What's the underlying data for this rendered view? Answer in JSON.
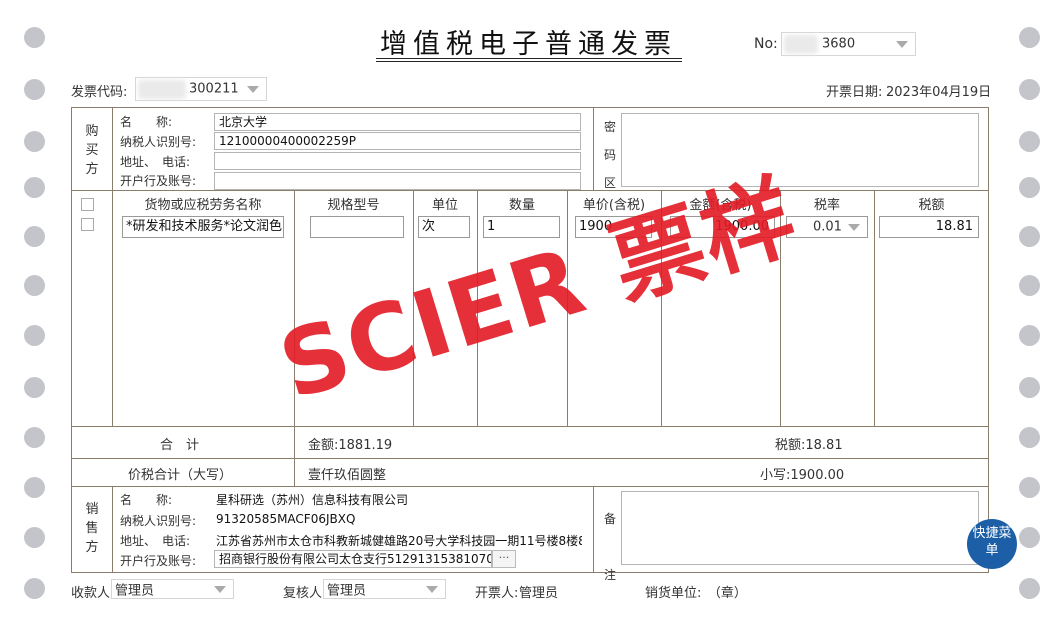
{
  "invoice": {
    "title": "增值税电子普通发票",
    "no_label": "No:",
    "no_value": "3680",
    "code_label": "发票代码:",
    "code_value": "300211",
    "date_label": "开票日期:",
    "date_value": "2023年04月19日"
  },
  "buyer": {
    "section_label": "购买方",
    "name_label": "名　　称:",
    "name_value": "北京大学",
    "tax_id_label": "纳税人识别号:",
    "tax_id_value": "12100000400002259P",
    "address_label": "地址、　电话:",
    "address_value": "",
    "bank_label": "开户行及账号:",
    "bank_value": ""
  },
  "password_label": "密码区",
  "items_header": {
    "goods": "货物或应税劳务名称",
    "spec": "规格型号",
    "unit": "单位",
    "qty": "数量",
    "price": "单价(含税)",
    "amount": "金额(含税)",
    "rate": "税率",
    "tax": "税额"
  },
  "item": {
    "goods": "*研发和技术服务*论文润色",
    "spec": "",
    "unit": "次",
    "qty": "1",
    "price": "1900",
    "amount": "1900.00",
    "rate": "0.01",
    "tax": "18.81"
  },
  "totals": {
    "label": "合　计",
    "amount_text": "金额:1881.19",
    "tax_text": "税额:18.81",
    "sum_label": "价税合计（大写）",
    "sum_upper": "壹仟玖佰圆整",
    "sum_lower": "小写:1900.00"
  },
  "seller": {
    "section_label": "销售方",
    "name_label": "名　　称:",
    "name_value": "星科研选（苏州）信息科技有限公司",
    "tax_id_label": "纳税人识别号:",
    "tax_id_value": "91320585MACF06JBXQ",
    "address_label": "地址、　电话:",
    "address_value": "江苏省苏州市太仓市科教新城健雄路20号大学科技园一期11号楼8楼8",
    "bank_label": "开户行及账号:",
    "bank_value": "招商银行股份有限公司太仓支行51291315381070",
    "more_label": "···"
  },
  "remarks_label": "备注",
  "footer": {
    "payee_label": "收款人:",
    "payee_value": "管理员",
    "reviewer_label": "复核人:",
    "reviewer_value": "管理员",
    "drawer_label": "开票人:",
    "drawer_value": "管理员",
    "seller_unit_label": "销货单位:　（章）"
  },
  "watermark": "SCIER 票样",
  "quick_menu_label": "快捷菜单",
  "colors": {
    "frame": "#8b7d6b",
    "watermark": "#e21a24",
    "quick_menu": "#1c5fa7",
    "hole": "#c3c5cb"
  }
}
